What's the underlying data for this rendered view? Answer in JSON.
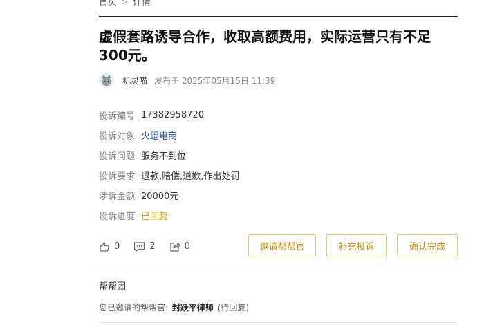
{
  "breadcrumb": {
    "home": "首页",
    "separator": ">",
    "current": "详情"
  },
  "title": "虚假套路诱导合作，收取高额费用，实际运营只有不足300元。",
  "author": {
    "name": "机灵喵",
    "published": "发布于 2025年05月15日 11:39"
  },
  "fields": [
    {
      "label": "投诉编号",
      "value": "17382958720"
    },
    {
      "label": "投诉对象",
      "value": "火蝠电商"
    },
    {
      "label": "投诉问题",
      "value": "服务不到位"
    },
    {
      "label": "投诉要求",
      "value": "退款,赔偿,道歉,作出处罚"
    },
    {
      "label": "涉诉金额",
      "value": "20000元"
    },
    {
      "label": "投诉进度",
      "value": "已回复"
    }
  ],
  "stats": {
    "likes": "0",
    "comments": "2",
    "shares": "0"
  },
  "buttons": {
    "invite": "邀请帮帮官",
    "supplement": "补充投诉",
    "confirm": "确认完成"
  },
  "team": {
    "title": "帮帮团",
    "invite_prefix": "您已邀请的帮帮官:",
    "lawyer": "封跃平律师",
    "status": "(待回复)"
  },
  "colors": {
    "accent": "#c7901a",
    "link": "#1f4d9c",
    "status": "#d4a017"
  }
}
